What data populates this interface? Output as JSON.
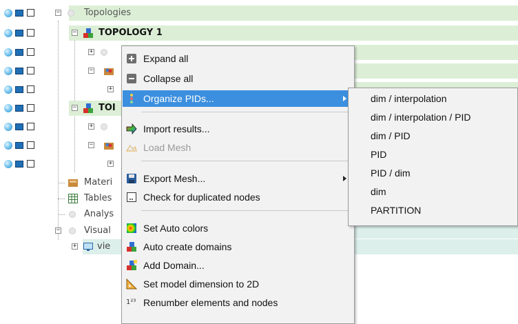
{
  "colors": {
    "row_highlight": "#dcefd6",
    "row_highlight_alt": "#dcefea",
    "menu_active": "#3c8fde"
  },
  "tree": {
    "root": "Topologies",
    "topology1": "TOPOLOGY 1",
    "topology2_partial": "TOI",
    "materials_partial": "Materi",
    "tables_partial": "Tables",
    "analysis_partial": "Analys",
    "visual_partial": "Visual",
    "view_partial": "vie"
  },
  "context_menu": {
    "items": [
      {
        "label": "Expand all",
        "icon": "expand-all-icon"
      },
      {
        "label": "Collapse all",
        "icon": "collapse-all-icon"
      },
      {
        "label": "Organize PIDs...",
        "icon": "organize-pids-icon"
      },
      {
        "label": "Import results...",
        "icon": "import-arrow-icon"
      },
      {
        "label": "Load Mesh",
        "icon": "load-mesh-icon"
      },
      {
        "label": "Export Mesh...",
        "icon": "save-disk-icon"
      },
      {
        "label": "Check for duplicated nodes",
        "icon": "check-nodes-icon"
      },
      {
        "label": "Set Auto colors",
        "icon": "color-spectrum-icon"
      },
      {
        "label": "Auto create domains",
        "icon": "domain-blocks-icon"
      },
      {
        "label": "Add Domain...",
        "icon": "add-domain-icon"
      },
      {
        "label": "Set model dimension to 2D",
        "icon": "set-square-icon"
      },
      {
        "label": "Renumber elements and nodes",
        "icon": "renumber-icon",
        "icon_text": "1²³"
      }
    ]
  },
  "submenu": {
    "items": [
      "dim / interpolation",
      "dim / interpolation / PID",
      "dim / PID",
      "PID",
      "PID / dim",
      "dim",
      "PARTITION"
    ]
  }
}
